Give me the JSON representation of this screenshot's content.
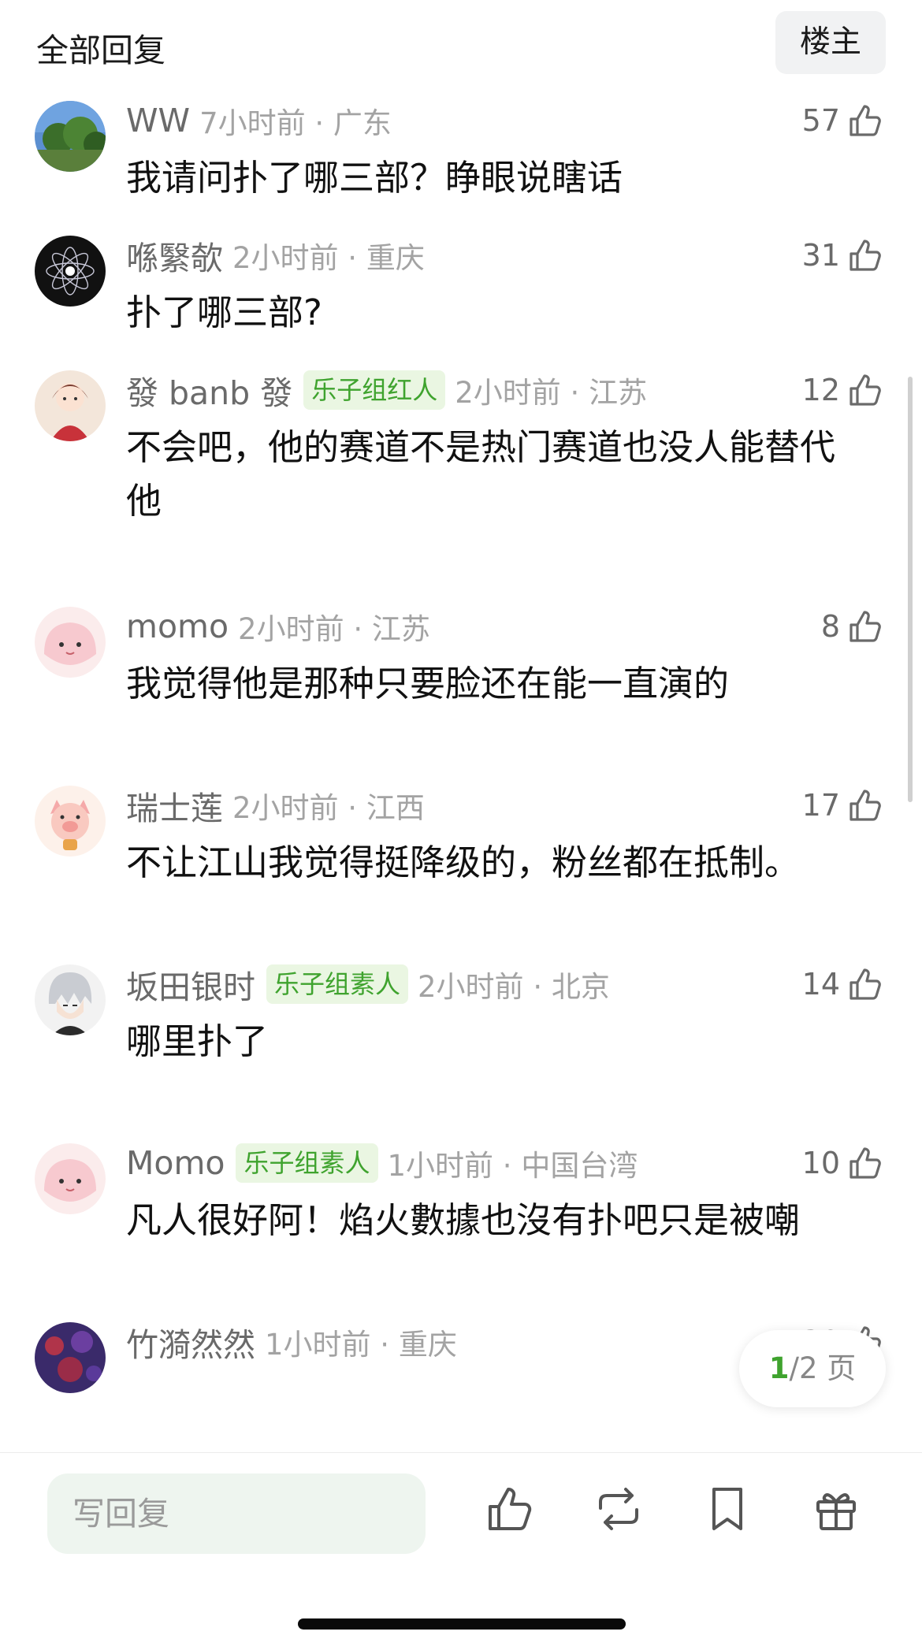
{
  "header": {
    "title": "全部回复",
    "owner_button": "楼主"
  },
  "comments": [
    {
      "user": "WW",
      "badge": "",
      "time": "7小时前 · 广东",
      "likes": "57",
      "text": "我请问扑了哪三部？睁眼说瞎话",
      "avatar": "landscape-trees"
    },
    {
      "user": "喺繄欹",
      "badge": "",
      "time": "2小时前 · 重庆",
      "likes": "31",
      "text": "扑了哪三部?",
      "avatar": "dark-flower"
    },
    {
      "user": "發 banb 發",
      "badge": "乐子组红人",
      "time": "2小时前 · 江苏",
      "likes": "12",
      "text": "不会吧，他的赛道不是热门赛道也没人能替代他",
      "avatar": "anime-girl-red"
    },
    {
      "user": "momo",
      "badge": "",
      "time": "2小时前 · 江苏",
      "likes": "8",
      "text": "我觉得他是那种只要脸还在能一直演的",
      "avatar": "pink-blob"
    },
    {
      "user": "瑞士莲",
      "badge": "",
      "time": "2小时前 · 江西",
      "likes": "17",
      "text": "不让江山我觉得挺降级的，粉丝都在抵制。",
      "avatar": "cartoon-pig"
    },
    {
      "user": "坂田银时",
      "badge": "乐子组素人",
      "time": "2小时前 · 北京",
      "likes": "14",
      "text": "哪里扑了",
      "avatar": "anime-silver-hair"
    },
    {
      "user": "Momo",
      "badge": "乐子组素人",
      "time": "1小时前 · 中国台湾",
      "likes": "10",
      "text": "凡人很好阿！焰火數據也沒有扑吧只是被嘲",
      "avatar": "pink-blob"
    },
    {
      "user": "竹漪然然",
      "badge": "",
      "time": "1小时前 · 重庆",
      "likes": "30",
      "text": "",
      "avatar": "purple-flowers"
    }
  ],
  "pager": {
    "current": "1",
    "total": "/2 页"
  },
  "bottom_bar": {
    "reply_placeholder": "写回复"
  },
  "colors": {
    "accent_green": "#3fa32e",
    "badge_bg": "#eaf6e2",
    "meta_gray": "#a3a3a3",
    "name_gray": "#6a6a6a"
  },
  "icons": {
    "like": "thumbs-up-icon",
    "repost": "repost-icon",
    "bookmark": "bookmark-icon",
    "gift": "gift-icon"
  }
}
